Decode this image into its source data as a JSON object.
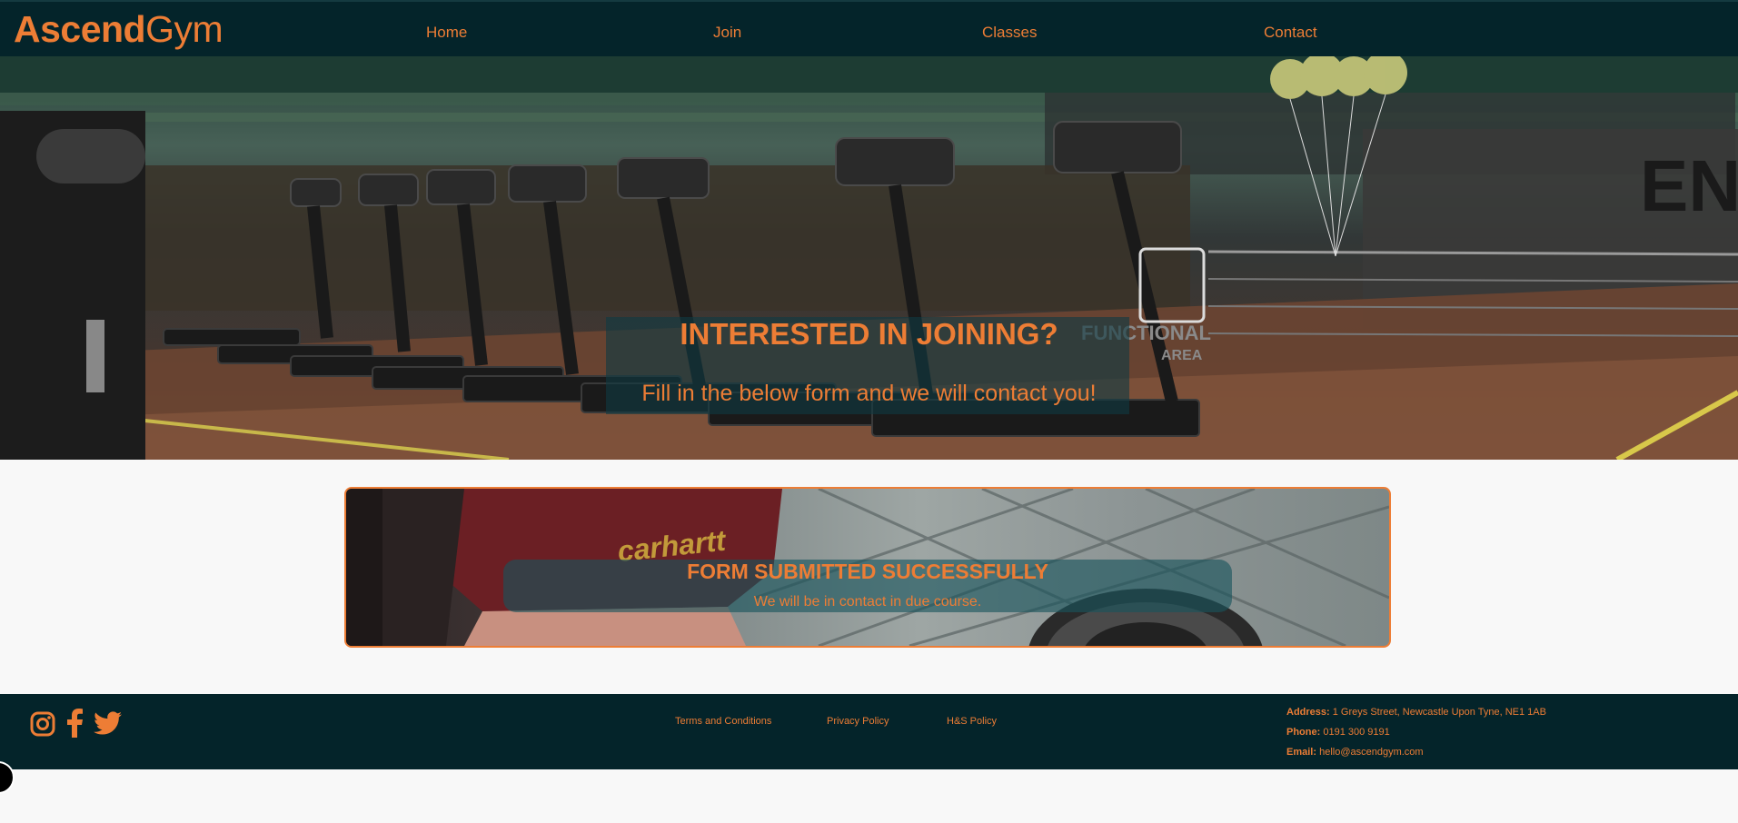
{
  "brand": {
    "logo_bold": "Ascend",
    "logo_light": "Gym"
  },
  "nav": {
    "items": [
      {
        "label": "Home"
      },
      {
        "label": "Join"
      },
      {
        "label": "Classes"
      },
      {
        "label": "Contact"
      }
    ]
  },
  "hero": {
    "title": "INTERESTED IN JOINING?",
    "subtitle": "Fill in the below form and we will contact you!",
    "background_text": [
      "FUNCTIONAL",
      "AREA"
    ]
  },
  "confirmation": {
    "title": "FORM SUBMITTED SUCCESSFULLY",
    "message": "We will be in contact in due course."
  },
  "footer": {
    "social_icons": [
      "instagram-icon",
      "facebook-icon",
      "twitter-icon"
    ],
    "links": [
      {
        "label": "Terms and Conditions"
      },
      {
        "label": "Privacy Policy"
      },
      {
        "label": "H&S Policy"
      }
    ],
    "contact": {
      "address_label": "Address:",
      "address": "1 Greys Street, Newcastle Upon Tyne, NE1 1AB",
      "phone_label": "Phone:",
      "phone": "0191 300 9191",
      "email_label": "Email:",
      "email": "hello@ascendgym.com"
    }
  },
  "colors": {
    "accent": "#ed7d35",
    "navbar_bg": "#04242a",
    "page_bg": "#f8f8f8",
    "overlay_teal": "#103a42"
  }
}
